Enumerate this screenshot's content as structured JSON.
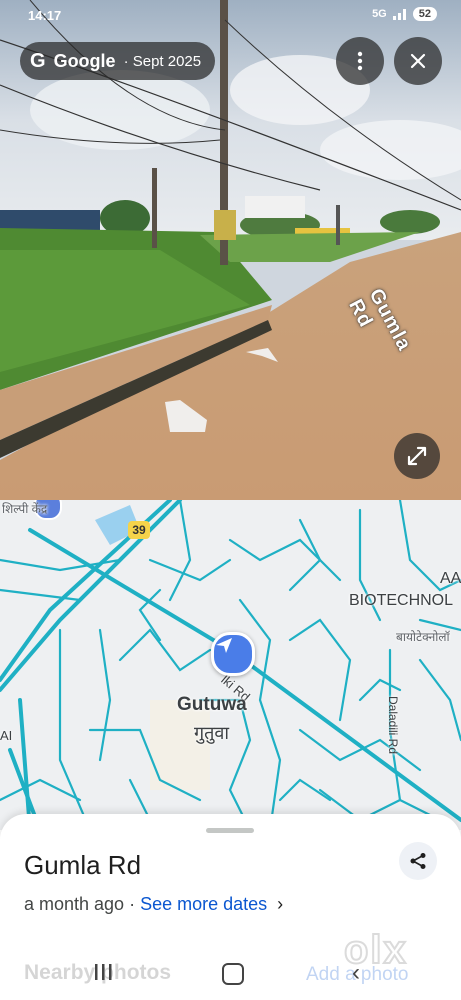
{
  "status_bar": {
    "time": "14:17",
    "battery": "52",
    "network": "5G"
  },
  "streetview": {
    "provider_glyph": "G",
    "provider": "Google",
    "date": "· Sept 2025",
    "road_label": "Gumla Rd",
    "icons": {
      "more": "more-vert-icon",
      "close": "close-icon",
      "expand": "expand-icon"
    }
  },
  "map": {
    "place_en": "Gutuwa",
    "place_hi": "गुतुवा",
    "biotech_en": "BIOTECHNOL",
    "biotech_hi": "बायोटेक्नोलॉ",
    "aa_label": "AA",
    "ai_label": "AI",
    "top_hi_label": "शिल्पी केंद्र",
    "road_lki": "lki Rd",
    "road_daladili": "Daladili Rd",
    "route_shield": "39",
    "colors": {
      "road": "#1fb0c4",
      "land": "#eef0f2",
      "water": "#9ad0ef",
      "pin": "#4a7de8"
    }
  },
  "sheet": {
    "title": "Gumla Rd",
    "age": "a month ago",
    "separator": " · ",
    "see_more": "See more dates",
    "nearby": "Nearby photos",
    "add_photo": "Add a photo",
    "watermark": "olx"
  }
}
